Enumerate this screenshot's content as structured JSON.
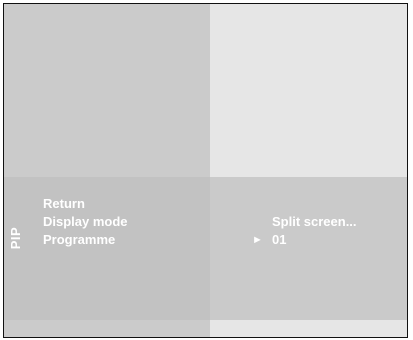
{
  "menu": {
    "side_title": "PIP",
    "items": [
      {
        "label": "Return",
        "value": ""
      },
      {
        "label": "Display mode",
        "value": "Split screen..."
      },
      {
        "label": "Programme",
        "value": "01",
        "pointer": "►"
      }
    ]
  },
  "colors": {
    "left_pane": "#cbcbcb",
    "right_pane": "#e6e6e6",
    "menu_band": "#c2c2c2",
    "text": "#ffffff"
  }
}
